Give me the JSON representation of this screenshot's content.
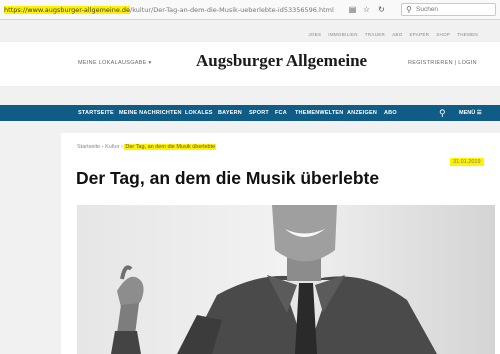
{
  "browser": {
    "url_highlight": "https://www.augsburger-allgemeine.de",
    "url_rest": "/kultur/Der-Tag-an-dem-die-Musik-ueberlebte-id53356596.html",
    "search_placeholder": "Suchen"
  },
  "topbar": [
    "JOBS",
    "IMMOBILIEN",
    "TRAUER",
    "ABO",
    "EPAPER",
    "SHOP",
    "THEMEN"
  ],
  "header": {
    "lokalausgabe": "MEINE LOKALAUSGABE",
    "logo": "Augsburger Allgemeine",
    "register": "REGISTRIEREN",
    "login": "LOGIN"
  },
  "nav": {
    "items": [
      "STARTSEITE",
      "MEINE NACHRICHTEN",
      "LOKALES",
      "BAYERN",
      "SPORT",
      "FCA",
      "THEMENWELTEN",
      "ANZEIGEN",
      "ABO"
    ],
    "menu": "MENÜ"
  },
  "article": {
    "breadcrumb": [
      "Startseite",
      "Kultur",
      "Der Tag, an dem die Musik überlebte"
    ],
    "date": "31.01.2019",
    "title": "Der Tag, an dem die Musik überlebte"
  }
}
